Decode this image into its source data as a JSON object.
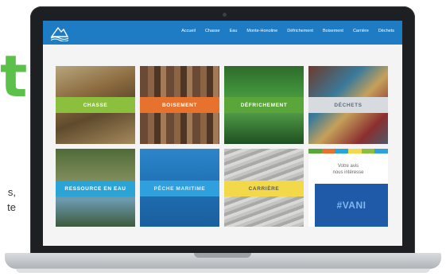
{
  "page": {
    "big_letter": "t",
    "side_text_1": "s,",
    "side_text_2": "te"
  },
  "site": {
    "logo_icon": "mountain-wave-logo",
    "nav": [
      "Accueil",
      "Chasse",
      "Eau",
      "Monte-Honoline",
      "Défrichement",
      "Boisement",
      "Carrière",
      "Déchets"
    ],
    "colors": {
      "topbar": "#1e7cc4",
      "chasse": "#8dbf3e",
      "boisement": "#e6722e",
      "defrichement": "#5aa63a",
      "dechets": "#d7dbe0",
      "ressource_eau": "#2aa3d7",
      "peche": "#2f9fde",
      "carriere": "#f2d94a",
      "vani": "#1e5aa8"
    },
    "tiles": [
      {
        "label": "CHASSE"
      },
      {
        "label": "BOISEMENT"
      },
      {
        "label": "DÉFRICHEMENT"
      },
      {
        "label": "DÉCHETS"
      },
      {
        "label": "RESSOURCE EN EAU"
      },
      {
        "label": "PÊCHE MARITIME"
      },
      {
        "label": "CARRIÈRE"
      }
    ],
    "promo": {
      "vote_line_1": "Votre avis",
      "vote_line_2": "nous intéresse",
      "hashtag": "#VANI",
      "stripe_colors": [
        "#5aa63a",
        "#e6722e",
        "#2aa3d7",
        "#f2d94a",
        "#8dbf3e",
        "#2f9fde"
      ]
    }
  }
}
